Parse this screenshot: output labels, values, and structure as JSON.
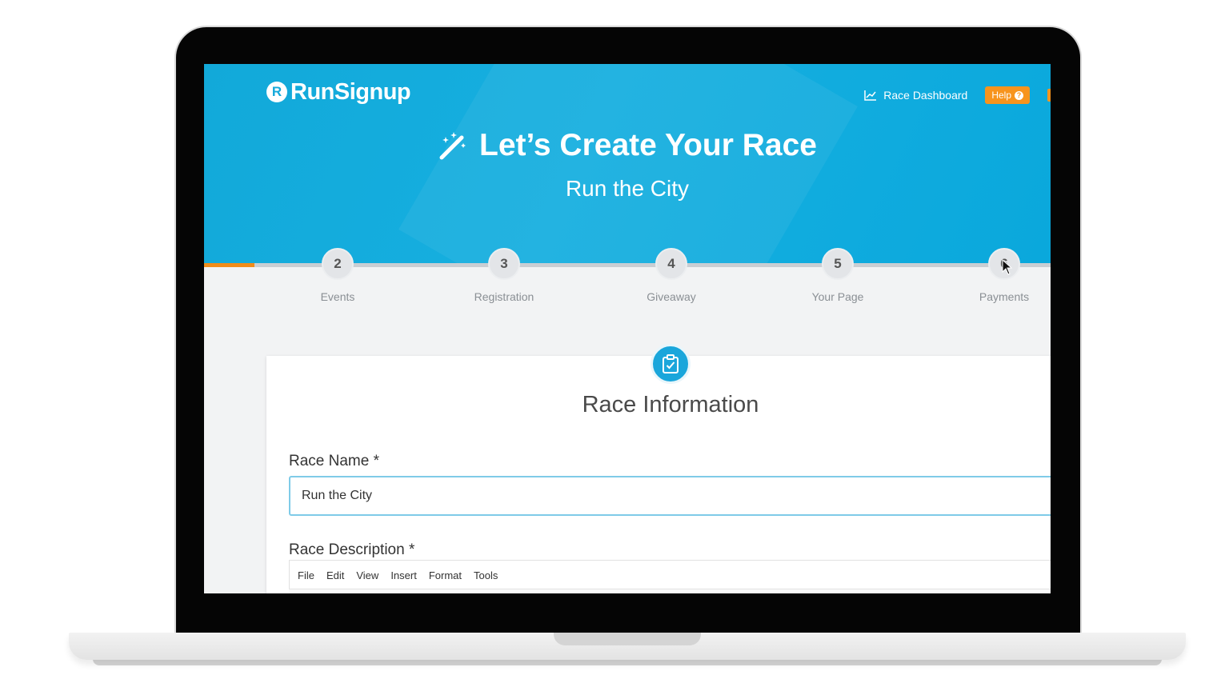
{
  "app": {
    "logo_text": "RunSignup",
    "logo_mark": "R"
  },
  "nav": {
    "dashboard_label": "Race Dashboard",
    "help_label": "Help",
    "help_icon": "?"
  },
  "hero": {
    "title": "Let’s Create Your Race",
    "subtitle": "Run the City"
  },
  "steps": [
    {
      "number": "2",
      "label": "Events"
    },
    {
      "number": "3",
      "label": "Registration"
    },
    {
      "number": "4",
      "label": "Giveaway"
    },
    {
      "number": "5",
      "label": "Your Page"
    },
    {
      "number": "6",
      "label": "Payments"
    }
  ],
  "progress": {
    "fraction": 0.06
  },
  "form": {
    "section_title": "Race Information",
    "race_name_label": "Race Name *",
    "race_name_value": "Run the City",
    "race_description_label": "Race Description *",
    "editor_menu": [
      "File",
      "Edit",
      "View",
      "Insert",
      "Format",
      "Tools"
    ]
  },
  "colors": {
    "brand_blue": "#16afe0",
    "accent_orange": "#f7941d"
  }
}
